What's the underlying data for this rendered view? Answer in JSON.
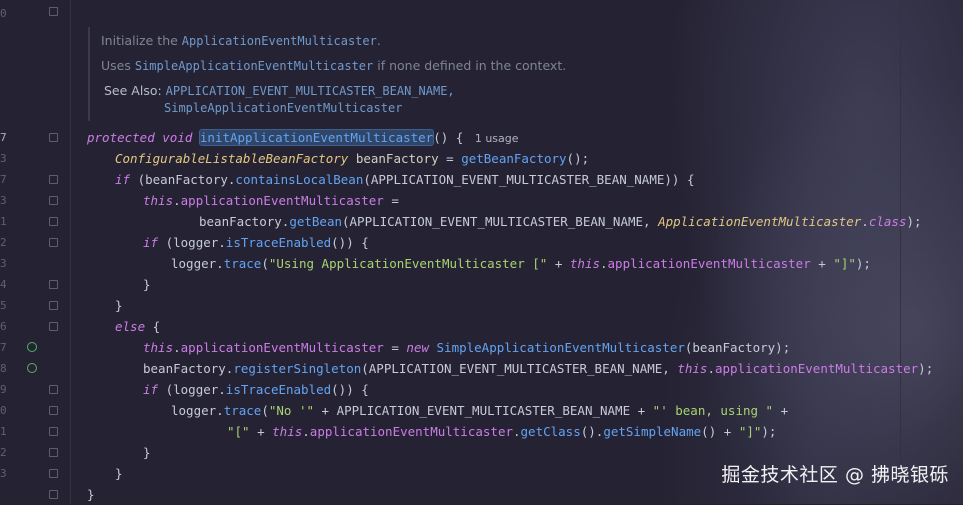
{
  "gutter": {
    "line_numbers": [
      "0",
      "",
      "",
      "",
      "",
      "",
      "7",
      "3",
      "7",
      "3",
      "1",
      "2",
      "3",
      "4",
      "5",
      "6",
      "7",
      "8",
      "9",
      "0",
      "1",
      "2",
      "3"
    ],
    "active_line": "7"
  },
  "doc": {
    "line1_text": "Initialize the ",
    "line1_ref": "ApplicationEventMulticaster",
    "line1_end": ".",
    "line2_prefix": "Uses ",
    "line2_ref": "SimpleApplicationEventMulticaster",
    "line2_suffix": " if none defined in the context.",
    "see_also_label": "See Also:",
    "see_also_1": "APPLICATION_EVENT_MULTICASTER_BEAN_NAME,",
    "see_also_2": "SimpleApplicationEventMulticaster"
  },
  "code": {
    "l1_protected": "protected",
    "l1_void": "void",
    "l1_method": "initApplicationEventMulticaster",
    "l1_rest": "() {",
    "l1_usage": "1 usage",
    "l2_type": "ConfigurableListableBeanFactory",
    "l2_var": " beanFactory",
    "l2_eq": " = ",
    "l2_call": "getBeanFactory",
    "l2_end": "();",
    "l3_if": "if",
    "l3_a": " (beanFactory.",
    "l3_call": "containsLocalBean",
    "l3_b": "(APPLICATION_EVENT_MULTICASTER_BEAN_NAME)) {",
    "l4_this": "this",
    "l4_dot": ".",
    "l4_field": "applicationEventMulticaster",
    "l4_end": " =",
    "l5_a": "beanFactory.",
    "l5_call": "getBean",
    "l5_b": "(APPLICATION_EVENT_MULTICASTER_BEAN_NAME, ",
    "l5_type": "ApplicationEventMulticaster",
    "l5_dot": ".",
    "l5_class": "class",
    "l5_end": ");",
    "l6_if": "if",
    "l6_a": " (logger.",
    "l6_call": "isTraceEnabled",
    "l6_end": "()) {",
    "l7_a": "logger.",
    "l7_call": "trace",
    "l7_b": "(",
    "l7_str": "\"Using ApplicationEventMulticaster [\"",
    "l7_plus": " + ",
    "l7_this": "this",
    "l7_dot": ".",
    "l7_field": "applicationEventMulticaster",
    "l7_plus2": " + ",
    "l7_str2": "\"]\"",
    "l7_end": ");",
    "l8": "}",
    "l9": "}",
    "l10_else": "else",
    "l10_end": " {",
    "l11_this": "this",
    "l11_dot": ".",
    "l11_field": "applicationEventMulticaster",
    "l11_eq": " = ",
    "l11_new": "new",
    "l11_call": " SimpleApplicationEventMulticaster",
    "l11_end": "(beanFactory);",
    "l12_a": "beanFactory.",
    "l12_call": "registerSingleton",
    "l12_b": "(APPLICATION_EVENT_MULTICASTER_BEAN_NAME, ",
    "l12_this": "this",
    "l12_dot": ".",
    "l12_field": "applicationEventMulticaster",
    "l12_end": ");",
    "l13_if": "if",
    "l13_a": " (logger.",
    "l13_call": "isTraceEnabled",
    "l13_end": "()) {",
    "l14_a": "logger.",
    "l14_call": "trace",
    "l14_b": "(",
    "l14_str": "\"No '\"",
    "l14_c": " + APPLICATION_EVENT_MULTICASTER_BEAN_NAME + ",
    "l14_str2": "\"' bean, using \"",
    "l14_end": " +",
    "l15_str": "\"[\"",
    "l15_plus": " + ",
    "l15_this": "this",
    "l15_dot": ".",
    "l15_field": "applicationEventMulticaster",
    "l15_dot2": ".",
    "l15_call": "getClass",
    "l15_b": "().",
    "l15_call2": "getSimpleName",
    "l15_c": "() + ",
    "l15_str2": "\"]\"",
    "l15_end": ");",
    "l16": "}",
    "l17": "}",
    "l18": "}"
  },
  "watermark": "掘金技术社区 @ 拂晓银砾",
  "colors": {
    "background": "#252333",
    "keyword": "#cc7ce6",
    "method": "#63a3f2",
    "type": "#e3c781",
    "string": "#a8d372",
    "implements_marker": "#4cb75c"
  }
}
